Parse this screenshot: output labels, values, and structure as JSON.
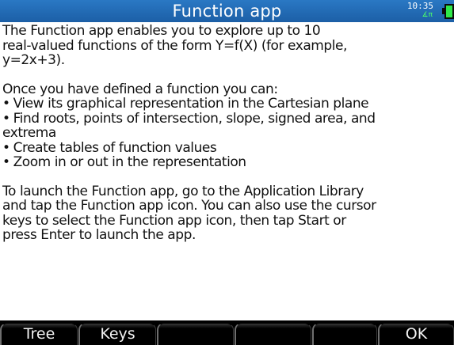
{
  "app_title": "Function app",
  "status": {
    "time": "10:35",
    "angle_mode": "∡π"
  },
  "help": {
    "paragraph1": "The Function app enables you to explore up to 10\nreal-valued functions of the form Y=f(X) (for example,\ny=2x+3).",
    "list_intro": "Once you have defined a function you can:",
    "list_items": [
      "View its graphical representation in the Cartesian plane",
      "Find roots, points of intersection, slope, signed area, and\nextrema",
      "Create tables of function values",
      "Zoom in or out in the representation"
    ],
    "paragraph3": "To launch the Function app, go to the Application Library\nand tap the Function app icon. You can also use the cursor\nkeys to select the Function app icon, then tap Start or\npress Enter to launch the app."
  },
  "softkeys": [
    "Tree",
    "Keys",
    "",
    "",
    "",
    "OK"
  ]
}
